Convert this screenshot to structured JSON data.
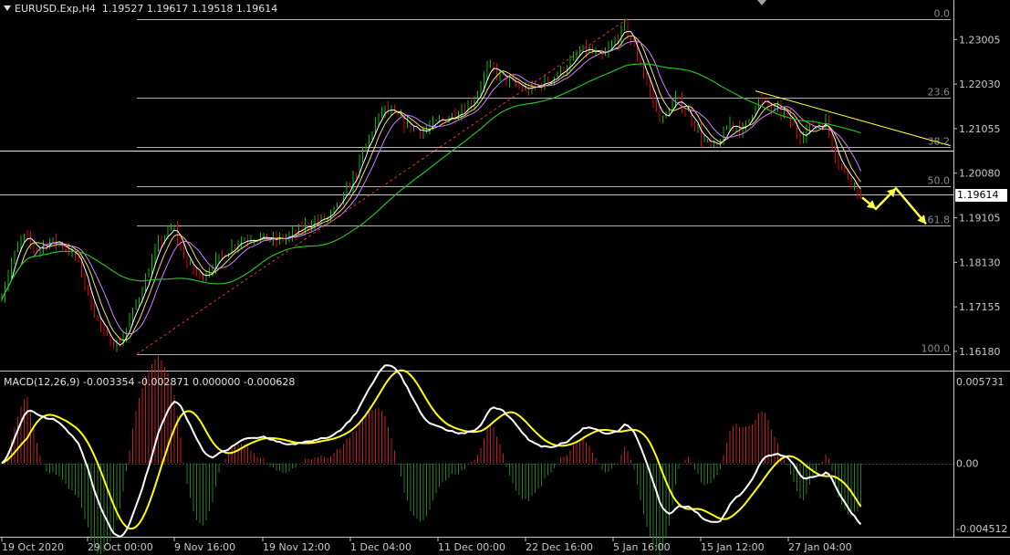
{
  "header": {
    "symbol": "EURUSD.Exp,H4",
    "ohlc": "1.19527 1.19617 1.19518 1.19614"
  },
  "macd_header": {
    "title": "MACD(12,26,9) -0.003354 -0.002871 0.000000 -0.000628"
  },
  "current_price": "1.19614",
  "colors": {
    "background": "#000000",
    "bull_candle": "#00c000",
    "bear_candle": "#e00000",
    "fib_lines": "#b0b0b0",
    "yellow_lines": "#ffff40",
    "ma_slow": "#20c020",
    "ma_purple": "#d080ff",
    "macd_line": "#ffffff",
    "signal_line": "#ffff00",
    "hist_pos": "#c02020",
    "hist_neg": "#208020"
  },
  "chart_data": [
    {
      "type": "candlestick",
      "title": "EURUSD.Exp,H4",
      "price_axis_labels": [
        "1.23005",
        "1.22030",
        "1.21055",
        "1.20080",
        "1.19105",
        "1.18130",
        "1.17155",
        "1.16180"
      ],
      "ylim": [
        1.158,
        1.2375
      ],
      "x_tick_labels": [
        "19 Oct 2020",
        "29 Oct 00:00",
        "9 Nov 16:00",
        "19 Nov 12:00",
        "1 Dec 04:00",
        "11 Dec 00:00",
        "22 Dec 16:00",
        "5 Jan 16:00",
        "15 Jan 12:00",
        "27 Jan 04:00"
      ],
      "fibonacci_levels": [
        {
          "label": "0.0",
          "price": 1.2346
        },
        {
          "label": "23.6",
          "price": 1.2173
        },
        {
          "label": "38.2",
          "price": 1.2066
        },
        {
          "label": "50.0",
          "price": 1.1979
        },
        {
          "label": "61.8",
          "price": 1.1893
        },
        {
          "label": "100.0",
          "price": 1.1612
        }
      ],
      "horizontal_lines": [
        1.2057,
        1.19614
      ],
      "trendline": {
        "from": [
          "mid Jan",
          1.2188
        ],
        "to": [
          "end",
          1.2068
        ]
      },
      "price_path": [
        [
          0,
          1.173
        ],
        [
          12,
          1.181
        ],
        [
          25,
          1.187
        ],
        [
          40,
          1.184
        ],
        [
          55,
          1.186
        ],
        [
          70,
          1.185
        ],
        [
          85,
          1.182
        ],
        [
          100,
          1.172
        ],
        [
          115,
          1.165
        ],
        [
          130,
          1.163
        ],
        [
          145,
          1.17
        ],
        [
          160,
          1.178
        ],
        [
          175,
          1.186
        ],
        [
          190,
          1.189
        ],
        [
          205,
          1.181
        ],
        [
          220,
          1.178
        ],
        [
          240,
          1.182
        ],
        [
          260,
          1.186
        ],
        [
          280,
          1.187
        ],
        [
          300,
          1.186
        ],
        [
          320,
          1.187
        ],
        [
          340,
          1.19
        ],
        [
          360,
          1.191
        ],
        [
          375,
          1.195
        ],
        [
          390,
          1.201
        ],
        [
          405,
          1.209
        ],
        [
          420,
          1.215
        ],
        [
          435,
          1.213
        ],
        [
          450,
          1.211
        ],
        [
          465,
          1.21
        ],
        [
          480,
          1.212
        ],
        [
          500,
          1.214
        ],
        [
          520,
          1.217
        ],
        [
          535,
          1.224
        ],
        [
          550,
          1.222
        ],
        [
          565,
          1.22
        ],
        [
          580,
          1.219
        ],
        [
          600,
          1.221
        ],
        [
          620,
          1.224
        ],
        [
          640,
          1.228
        ],
        [
          660,
          1.226
        ],
        [
          675,
          1.23
        ],
        [
          685,
          1.233
        ],
        [
          695,
          1.228
        ],
        [
          705,
          1.223
        ],
        [
          715,
          1.217
        ],
        [
          725,
          1.212
        ],
        [
          740,
          1.217
        ],
        [
          755,
          1.214
        ],
        [
          770,
          1.208
        ],
        [
          785,
          1.206
        ],
        [
          800,
          1.212
        ],
        [
          815,
          1.21
        ],
        [
          830,
          1.217
        ],
        [
          845,
          1.215
        ],
        [
          860,
          1.214
        ],
        [
          875,
          1.209
        ],
        [
          890,
          1.211
        ],
        [
          905,
          1.212
        ],
        [
          915,
          1.205
        ],
        [
          925,
          1.201
        ],
        [
          935,
          1.199
        ],
        [
          945,
          1.195
        ]
      ],
      "projection_arrows": [
        [
          945,
          1.1955
        ],
        [
          960,
          1.193
        ],
        [
          982,
          1.1975
        ],
        [
          1015,
          1.1897
        ]
      ]
    },
    {
      "type": "macd",
      "title": "MACD(12,26,9)",
      "params": [
        12,
        26,
        9
      ],
      "values": {
        "macd": -0.003354,
        "signal": -0.002871,
        "zero": 0.0,
        "histogram": -0.000628
      },
      "axis_labels": [
        "0.005731",
        "0.00",
        "-0.004512"
      ],
      "ylim": [
        -0.00475,
        0.0059
      ]
    }
  ]
}
